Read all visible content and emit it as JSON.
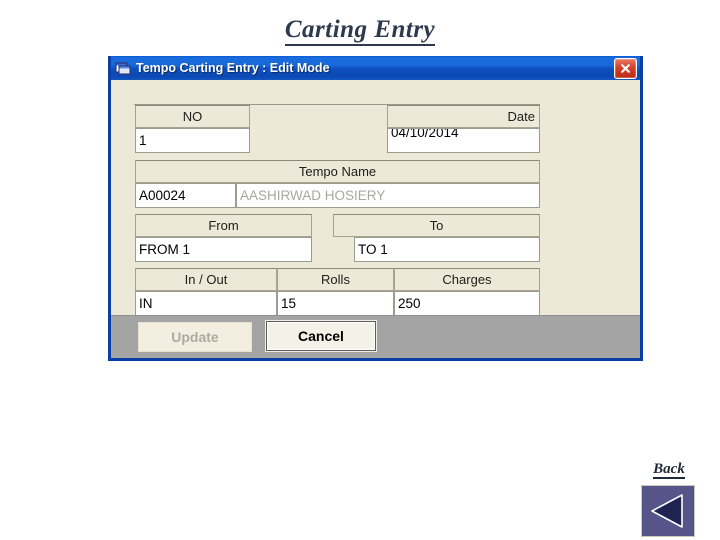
{
  "page": {
    "title": "Carting Entry",
    "background_color": "#ffffff",
    "title_color": "#2d3a4d"
  },
  "dialog": {
    "titlebar": {
      "icon": "vb-form-icon",
      "title": "Tempo Carting Entry : Edit Mode",
      "close_icon": "close-icon",
      "accent_color": "#0b3fa8",
      "client_color": "#ece9d8"
    },
    "fields": {
      "no": {
        "label": "NO",
        "value": "1"
      },
      "date": {
        "label": "Date",
        "value": "04/10/2014"
      },
      "tempo_name": {
        "label": "Tempo Name",
        "code_value": "A00024",
        "name_value": "AASHIRWAD HOSIERY",
        "name_color": "#a8a8a0"
      },
      "from": {
        "label": "From",
        "value": "FROM 1"
      },
      "to": {
        "label": "To",
        "value": "TO 1"
      },
      "in_out": {
        "label": "In / Out",
        "value": "IN"
      },
      "rolls": {
        "label": "Rolls",
        "value": "15"
      },
      "charges": {
        "label": "Charges",
        "value": "250"
      }
    },
    "buttons": {
      "update": {
        "label": "Update",
        "enabled": false
      },
      "cancel": {
        "label": "Cancel",
        "enabled": true
      }
    },
    "button_bar_color": "#a4a4a4"
  },
  "back": {
    "label": "Back",
    "icon": "left-triangle-icon",
    "button_color": "#55558a"
  }
}
